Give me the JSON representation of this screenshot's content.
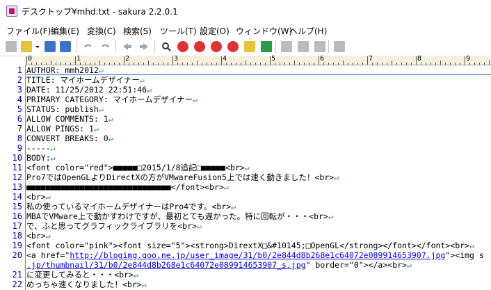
{
  "window": {
    "title": "デスクトップ¥mhd.txt - sakura 2.2.0.1"
  },
  "menu": [
    {
      "label": "ファイル(F)"
    },
    {
      "label": "編集(E)"
    },
    {
      "label": "変換(C)"
    },
    {
      "label": "検索(S)"
    },
    {
      "label": "ツール(T)"
    },
    {
      "label": "設定(O)"
    },
    {
      "label": "ウィンドウ(W)"
    },
    {
      "label": "ヘルプ(H)"
    }
  ],
  "toolbar": {
    "icons": [
      "new-file-icon",
      "open-folder-icon",
      "dropdown-arrow-icon",
      "save-icon",
      "save-all-icon",
      "undo-icon",
      "redo-icon",
      "back-icon",
      "forward-icon",
      "search-icon",
      "search-next-icon",
      "search-prev-icon",
      "replace-icon",
      "grep-icon",
      "bookmark-icon",
      "tag-jump-icon",
      "outline-icon",
      "font-icon",
      "settings-icon",
      "window-list-icon"
    ]
  },
  "ruler": {
    "labels": [
      "0",
      "1",
      "2",
      "3",
      "4",
      "5",
      "6",
      "7",
      "8",
      "9"
    ]
  },
  "lines": [
    {
      "n": "1",
      "text": "AUTHOR: mmh2012",
      "eol": "↵"
    },
    {
      "n": "2",
      "text": "TITLE: マイホームデザイナー",
      "eol": "↵"
    },
    {
      "n": "3",
      "text": "DATE: 11/25/2012 22:51:46",
      "eol": "↵"
    },
    {
      "n": "4",
      "text": "PRIMARY CATEGORY: マイホームデザイナー",
      "eol": "↵"
    },
    {
      "n": "5",
      "text": "STATUS: publish",
      "eol": "↵"
    },
    {
      "n": "6",
      "text": "ALLOW COMMENTS: 1",
      "eol": "↵"
    },
    {
      "n": "7",
      "text": "ALLOW PINGS: 1",
      "eol": "↵"
    },
    {
      "n": "8",
      "text": "CONVERT BREAKS: 0",
      "eol": "↵"
    },
    {
      "n": "9",
      "text": "-----",
      "eol": "↵"
    },
    {
      "n": "10",
      "text": "BODY:",
      "eol": "↵"
    },
    {
      "n": "11",
      "text": "<font color=\"red\">■■■■■□2015/1/8追記□■■■■■<br>",
      "eol": "↵"
    },
    {
      "n": "12",
      "text": "Pro7ではOpenGLよりDirectXの方がVMwareFusion5上では速く動きました！<br>",
      "eol": "↵"
    },
    {
      "n": "13",
      "text": "■■■■■■■■■■■■■■■■■■■■■■■■■■■■■■</font><br>",
      "eol": "↵"
    },
    {
      "n": "14",
      "text": "<br>",
      "eol": "↵"
    },
    {
      "n": "15",
      "text": "私の使っているマイホームデザイナーはPro4です。<br>",
      "eol": "↵"
    },
    {
      "n": "16",
      "text": "MBAでVMware上で動かすわけですが、最初とても遅かった。特に回転が・・・<br>",
      "eol": "↵"
    },
    {
      "n": "17",
      "text": "で、ふと思ってグラフィックライブラリを<br>",
      "eol": "↵"
    },
    {
      "n": "18",
      "text": "<br>",
      "eol": "↵"
    },
    {
      "n": "19",
      "text": "<font color=\"pink\"><font size=\"5\"><strong>DirextX□&#10145;□OpenGL</strong></font></font><br>",
      "eol": "↵"
    },
    {
      "n": "20",
      "pre": "<a href=\"",
      "url": "http://blogimg.goo.ne.jp/user_image/31/b0/2e844d8b268e1c64072e089914653907.jpg",
      "post": "\"><img s",
      "eol": ""
    },
    {
      "n": "",
      "pre": "",
      "url": ".jp/thumbnail/31/b0/2e844d8b268e1c64072e089914653907_s.jpg",
      "post": "\" border=\"0\"></a><br>",
      "eol": "↵"
    },
    {
      "n": "21",
      "text": "に変更してみると・・・<br>",
      "eol": "↵"
    },
    {
      "n": "22",
      "text": "めっちゃ速くなりました！<br>",
      "eol": "↵"
    }
  ]
}
